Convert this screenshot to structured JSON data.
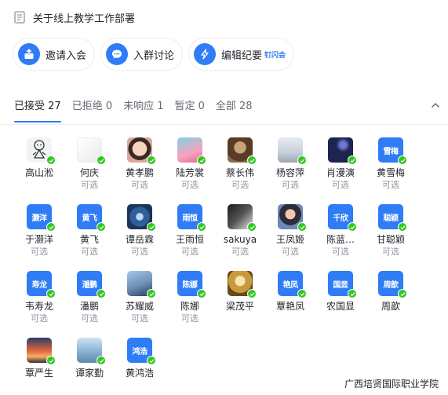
{
  "meeting": {
    "title": "关于线上教学工作部署"
  },
  "actions": [
    {
      "label": "邀请入会",
      "icon": "invite-icon"
    },
    {
      "label": "入群讨论",
      "icon": "chat-icon"
    },
    {
      "label": "编辑纪要",
      "icon": "edit-icon",
      "badge": "钉闪会"
    }
  ],
  "tabs": [
    {
      "label": "已接受 27",
      "active": true
    },
    {
      "label": "已拒绝 0"
    },
    {
      "label": "未响应 1"
    },
    {
      "label": "暂定 0"
    },
    {
      "label": "全部 28"
    }
  ],
  "members": [
    {
      "name": "高山淞",
      "sub": "",
      "avatar": {
        "kind": "pic",
        "style": "cartoon"
      }
    },
    {
      "name": "何庆",
      "sub": "可选",
      "avatar": {
        "kind": "pic",
        "style": "sketch"
      }
    },
    {
      "name": "黄孝鹏",
      "sub": "可选",
      "avatar": {
        "kind": "pic",
        "style": "child"
      }
    },
    {
      "name": "陆芳裳",
      "sub": "可选",
      "avatar": {
        "kind": "pic",
        "style": "teal"
      }
    },
    {
      "name": "蔡长伟",
      "sub": "可选",
      "avatar": {
        "kind": "pic",
        "style": "brown"
      }
    },
    {
      "name": "杨容萍",
      "sub": "可选",
      "avatar": {
        "kind": "pic",
        "style": "light"
      }
    },
    {
      "name": "肖漫演",
      "sub": "可选",
      "avatar": {
        "kind": "pic",
        "style": "dark"
      }
    },
    {
      "name": "黄雪梅",
      "sub": "可选",
      "avatar": {
        "kind": "text",
        "text": "雪梅"
      }
    },
    {
      "name": "于灏洋",
      "sub": "可选",
      "avatar": {
        "kind": "text",
        "text": "灏洋"
      }
    },
    {
      "name": "黄飞",
      "sub": "可选",
      "avatar": {
        "kind": "text",
        "text": "黄飞"
      }
    },
    {
      "name": "谭岳霖",
      "sub": "可选",
      "avatar": {
        "kind": "pic",
        "style": "navy"
      }
    },
    {
      "name": "王雨恒",
      "sub": "可选",
      "avatar": {
        "kind": "text",
        "text": "雨恒"
      }
    },
    {
      "name": "sakuya",
      "sub": "可选",
      "avatar": {
        "kind": "pic",
        "style": "anime"
      }
    },
    {
      "name": "王凤姬",
      "sub": "可选",
      "avatar": {
        "kind": "pic",
        "style": "woman"
      }
    },
    {
      "name": "陈蓝…",
      "sub": "可选",
      "avatar": {
        "kind": "text",
        "text": "千欣"
      }
    },
    {
      "name": "甘聪颖",
      "sub": "可选",
      "avatar": {
        "kind": "text",
        "text": "聪颖"
      }
    },
    {
      "name": "韦寿龙",
      "sub": "可选",
      "avatar": {
        "kind": "text",
        "text": "寿龙"
      }
    },
    {
      "name": "潘鹏",
      "sub": "可选",
      "avatar": {
        "kind": "text",
        "text": "潘鹏"
      }
    },
    {
      "name": "苏耀威",
      "sub": "可选",
      "avatar": {
        "kind": "pic",
        "style": "plane"
      }
    },
    {
      "name": "陈娜",
      "sub": "可选",
      "avatar": {
        "kind": "text",
        "text": "陈娜"
      }
    },
    {
      "name": "梁茂平",
      "sub": "",
      "avatar": {
        "kind": "pic",
        "style": "golden"
      }
    },
    {
      "name": "覃艳凤",
      "sub": "",
      "avatar": {
        "kind": "text",
        "text": "艳凤"
      }
    },
    {
      "name": "农国显",
      "sub": "",
      "avatar": {
        "kind": "text",
        "text": "国显"
      }
    },
    {
      "name": "周歆",
      "sub": "",
      "avatar": {
        "kind": "text",
        "text": "周歆"
      }
    },
    {
      "name": "覃严生",
      "sub": "",
      "avatar": {
        "kind": "pic",
        "style": "sunset"
      }
    },
    {
      "name": "谭家勤",
      "sub": "",
      "avatar": {
        "kind": "pic",
        "style": "sea"
      }
    },
    {
      "name": "黄鸿浩",
      "sub": "",
      "avatar": {
        "kind": "text",
        "text": "鸿浩"
      }
    }
  ],
  "watermark": "广西培贤国际职业学院",
  "colors": {
    "accent": "#2f7cf6",
    "accepted": "#34c724"
  }
}
